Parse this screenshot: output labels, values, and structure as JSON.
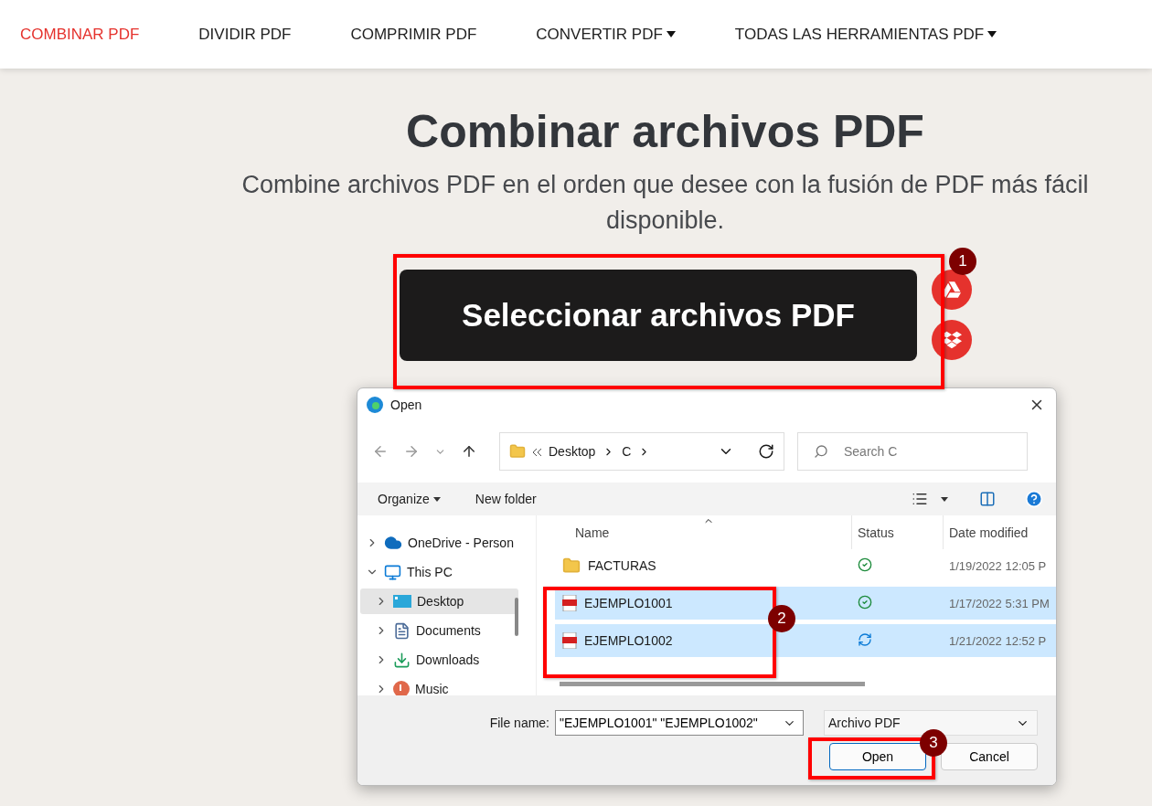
{
  "nav": {
    "items": [
      {
        "label": "COMBINAR PDF",
        "selected": true,
        "dropdown": false
      },
      {
        "label": "DIVIDIR PDF",
        "selected": false,
        "dropdown": false
      },
      {
        "label": "COMPRIMIR PDF",
        "selected": false,
        "dropdown": false
      },
      {
        "label": "CONVERTIR PDF",
        "selected": false,
        "dropdown": true
      },
      {
        "label": "TODAS LAS HERRAMIENTAS PDF",
        "selected": false,
        "dropdown": true
      }
    ]
  },
  "hero": {
    "title": "Combinar archivos PDF",
    "subtitle": "Combine archivos PDF en el orden que desee con la fusión de PDF más fácil disponible.",
    "button": "Seleccionar archivos PDF"
  },
  "dialog": {
    "title": "Open",
    "path": [
      "Desktop",
      "C"
    ],
    "search": {
      "placeholder": "Search C"
    },
    "toolbar": [
      "Organize",
      "New folder"
    ],
    "sidebar": [
      {
        "label": "OneDrive - Person",
        "kind": "cloud",
        "expanded": false,
        "selected": false
      },
      {
        "label": "This PC",
        "kind": "computer",
        "expanded": true,
        "selected": false,
        "children": [
          {
            "label": "Desktop",
            "kind": "desktop",
            "expanded": false,
            "selected": true
          },
          {
            "label": "Documents",
            "kind": "documents",
            "expanded": false,
            "selected": false
          },
          {
            "label": "Downloads",
            "kind": "downloads",
            "expanded": false,
            "selected": false
          },
          {
            "label": "Music",
            "kind": "music",
            "expanded": false,
            "selected": false
          }
        ]
      }
    ],
    "columns": [
      "Name",
      "Status",
      "Date modified"
    ],
    "rows": [
      {
        "name": "FACTURAS",
        "kind": "folder",
        "synced": true,
        "date": "1/19/2022 12:05 P",
        "selected": false
      },
      {
        "name": "EJEMPLO1001",
        "kind": "pdf",
        "synced": true,
        "date": "1/17/2022 5:31 PM",
        "selected": true
      },
      {
        "name": "EJEMPLO1002",
        "kind": "pdf",
        "synced": false,
        "date": "1/21/2022 12:52 P",
        "selected": true
      }
    ],
    "file_name": {
      "label": "File name:",
      "value": "\"EJEMPLO1001\" \"EJEMPLO1002\""
    },
    "file_type": "Archivo PDF",
    "buttons": [
      {
        "label": "Open",
        "kind": "primary"
      },
      {
        "label": "Cancel",
        "kind": "secondary"
      }
    ]
  },
  "annotations": [
    {
      "label": "1"
    },
    {
      "label": "2"
    },
    {
      "label": "3"
    }
  ]
}
